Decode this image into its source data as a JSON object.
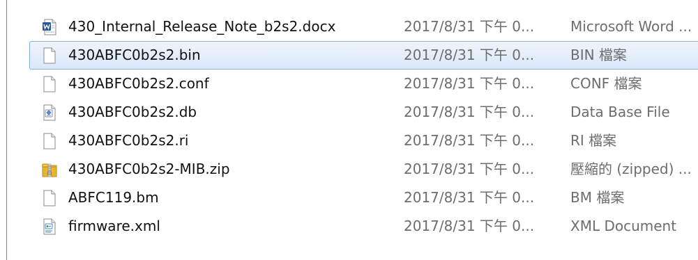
{
  "files": [
    {
      "icon": "word-document-icon",
      "name": "430_Internal_Release_Note_b2s2.docx",
      "date": "2017/8/31 下午 0...",
      "type": "Microsoft Word ..."
    },
    {
      "icon": "blank-file-icon",
      "name": "430ABFC0b2s2.bin",
      "date": "2017/8/31 下午 0...",
      "type": "BIN 檔案",
      "selected": true
    },
    {
      "icon": "blank-file-icon",
      "name": "430ABFC0b2s2.conf",
      "date": "2017/8/31 下午 0...",
      "type": "CONF 檔案"
    },
    {
      "icon": "database-file-icon",
      "name": "430ABFC0b2s2.db",
      "date": "2017/8/31 下午 0...",
      "type": "Data Base File"
    },
    {
      "icon": "blank-file-icon",
      "name": "430ABFC0b2s2.ri",
      "date": "2017/8/31 下午 0...",
      "type": "RI 檔案"
    },
    {
      "icon": "zip-folder-icon",
      "name": "430ABFC0b2s2-MIB.zip",
      "date": "2017/8/31 下午 0...",
      "type": "壓縮的 (zipped) ..."
    },
    {
      "icon": "blank-file-icon",
      "name": "ABFC119.bm",
      "date": "2017/8/31 下午 0...",
      "type": "BM 檔案"
    },
    {
      "icon": "xml-document-icon",
      "name": "firmware.xml",
      "date": "2017/8/31 下午 0...",
      "type": "XML Document"
    }
  ],
  "colors": {
    "selection_fill": "#dbe8f9",
    "selection_border": "#84acdd",
    "word_blue": "#2b5797",
    "zip_yellow": "#e8b62c"
  }
}
